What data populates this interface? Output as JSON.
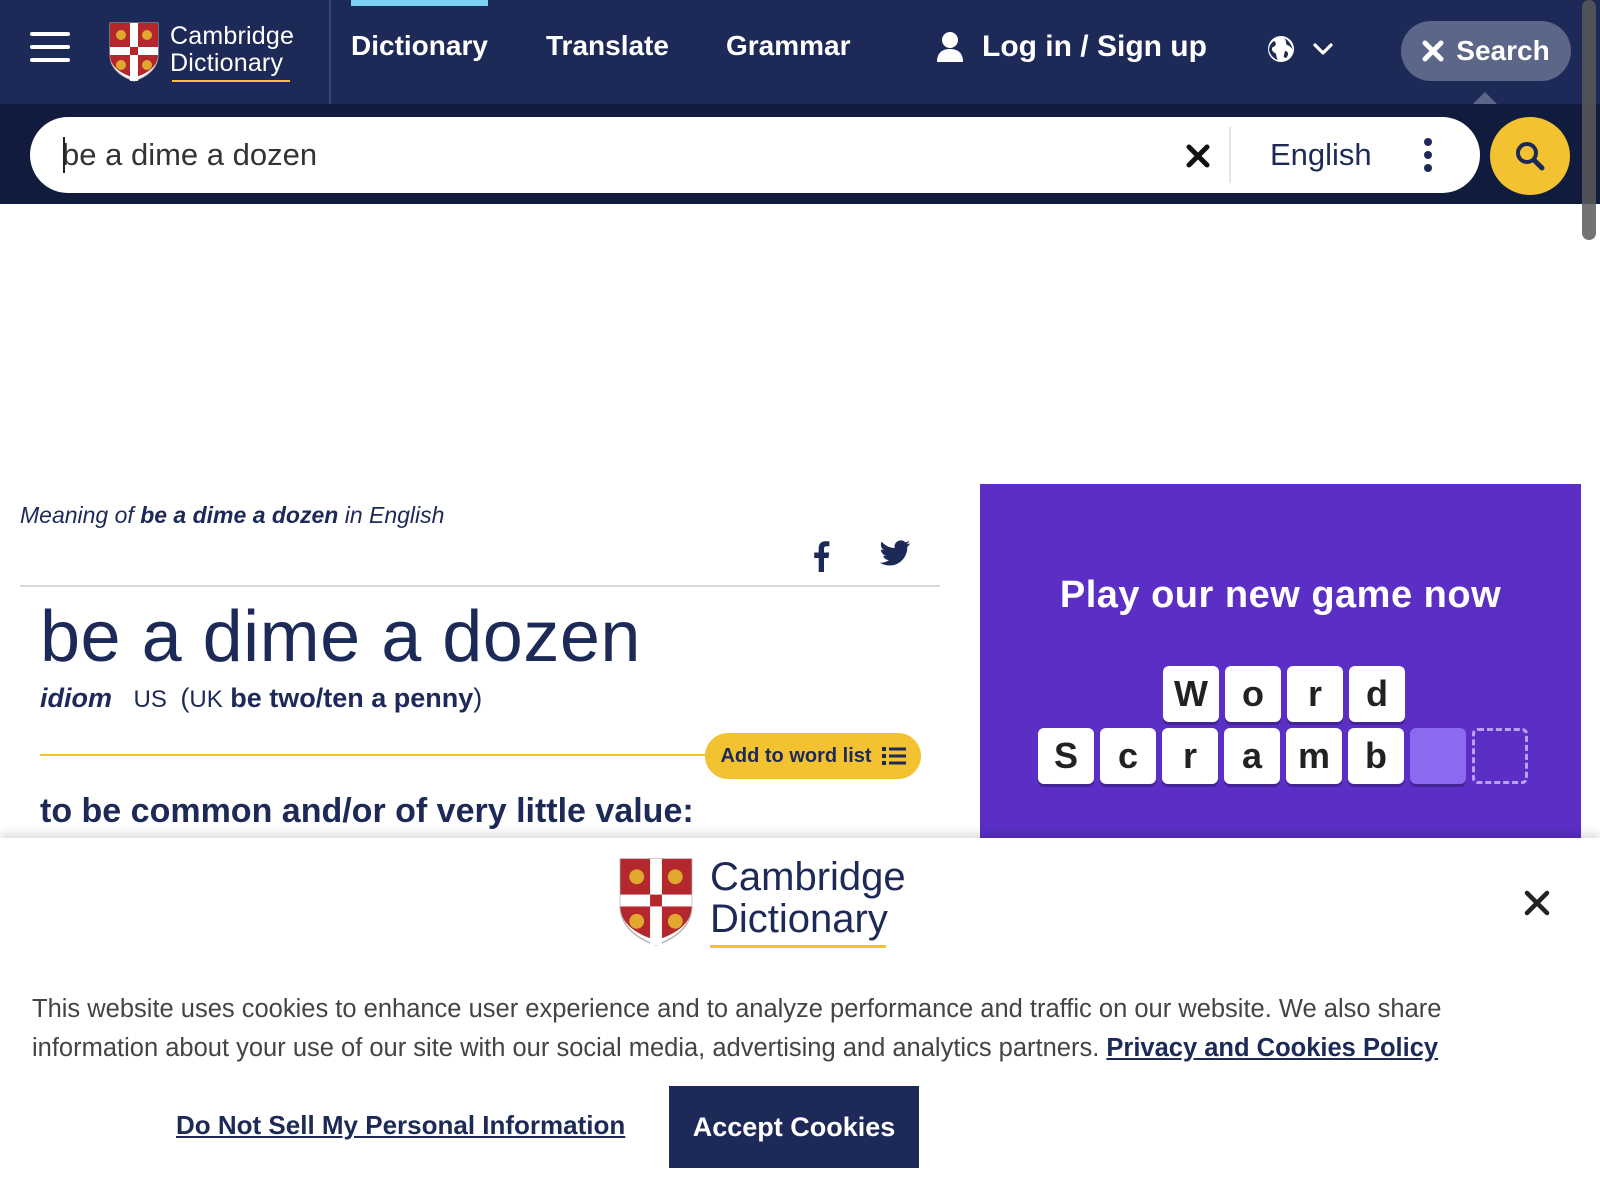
{
  "header": {
    "brand_line1": "Cambridge",
    "brand_line2": "Dictionary",
    "nav": {
      "dictionary": "Dictionary",
      "translate": "Translate",
      "grammar": "Grammar"
    },
    "login_label": "Log in / Sign up",
    "search_toggle_label": "Search",
    "colors": {
      "navy": "#1d2a57",
      "accent_yellow": "#f2c230",
      "active_tab": "#7bd1f2"
    }
  },
  "search": {
    "value": "be a dime a dozen",
    "language": "English"
  },
  "entry": {
    "meaning_prefix": "Meaning of ",
    "meaning_term": "be a dime a dozen",
    "meaning_suffix": " in English",
    "headword": "be a dime a dozen",
    "pos": "idiom",
    "region_us": "US",
    "open_paren": "(",
    "region_uk": "UK",
    "variant": "be two/ten a penny",
    "close_paren": ")",
    "add_to_word_list": "Add to word list",
    "definition": "to be common and/or of very little value:"
  },
  "ad": {
    "title": "Play our new game now",
    "word1": [
      "W",
      "o",
      "r",
      "d"
    ],
    "word2": [
      "S",
      "c",
      "r",
      "a",
      "m",
      "b"
    ],
    "background": "#5b2fc6"
  },
  "cookie_banner": {
    "brand_line1": "Cambridge",
    "brand_line2": "Dictionary",
    "text": "This website uses cookies to enhance user experience and to analyze performance and traffic on our website. We also share information about your use of our site with our social media, advertising and analytics partners.",
    "policy_link": "Privacy and Cookies Policy",
    "do_not_sell": "Do Not Sell My Personal Information",
    "accept": "Accept Cookies"
  }
}
